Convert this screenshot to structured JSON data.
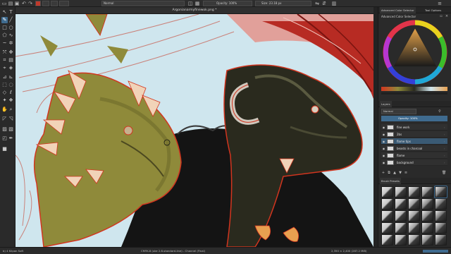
{
  "toolbar": {
    "blend_mode": "Normal",
    "opacity": "Opacity: 100%",
    "size": "Size: 23.18 px"
  },
  "document": {
    "title": "Argonianarmyfinewok.png *"
  },
  "status": {
    "left": "b) 4 Kilpan Soft",
    "middle": "CMYK-8 (uke 2.8-standard-line) - Channel (Final)",
    "right": "2,350 × 2,400 (287.2 MiB)"
  },
  "dock": {
    "color_tabs": [
      "Advanced Color Selector",
      "Tool Options"
    ],
    "color_panel_title": "Advanced Color Selector",
    "layers_panel_title": "Layers",
    "layers_blend": "Normal",
    "layers_opacity": "Opacity: 100%",
    "layers": [
      {
        "name": "fine work",
        "selected": false
      },
      {
        "name": "2bs",
        "selected": false
      },
      {
        "name": "flame tips",
        "selected": true
      },
      {
        "name": "beasts in charcoal",
        "selected": false
      },
      {
        "name": "flame",
        "selected": false
      },
      {
        "name": "background",
        "selected": false
      }
    ],
    "brushes_panel_title": "Brush Presets"
  },
  "icons": {
    "tool": [
      "pointer-icon",
      "text-icon",
      "brush-icon",
      "line-icon",
      "rect-icon",
      "ellipse-icon",
      "polygon-icon",
      "path-icon",
      "fill-icon",
      "gradient-icon",
      "colorpicker-icon",
      "transform-icon",
      "move-icon",
      "crop-icon",
      "selection-icon",
      "pan-icon",
      "zoom-icon"
    ]
  },
  "colors": {
    "canvas_bg": "#cfe6ee",
    "accent": "#3f6b8f",
    "dragon_left": "#8f8a3a",
    "dragon_right": "#2a2a1e",
    "outline_red": "#d2351f"
  }
}
